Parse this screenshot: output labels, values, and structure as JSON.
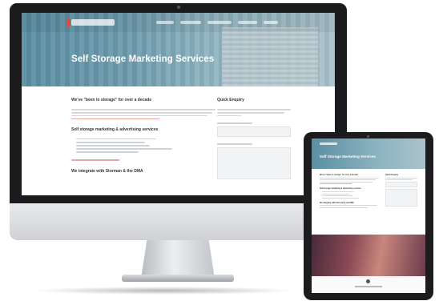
{
  "site": {
    "hero_title": "Self Storage Marketing Services",
    "section1_heading": "We've \"been in storage\" for over a decade",
    "section2_heading": "Self storage marketing & advertising services",
    "section3_heading": "We integrate with Storman & the DMA",
    "sidebar_heading": "Quick Enquiry"
  },
  "colors": {
    "hero_teal": "#5a8fa3",
    "accent_red": "#e04b3a",
    "device_black": "#1b1b1d",
    "footer_band": "#8a4a55"
  }
}
